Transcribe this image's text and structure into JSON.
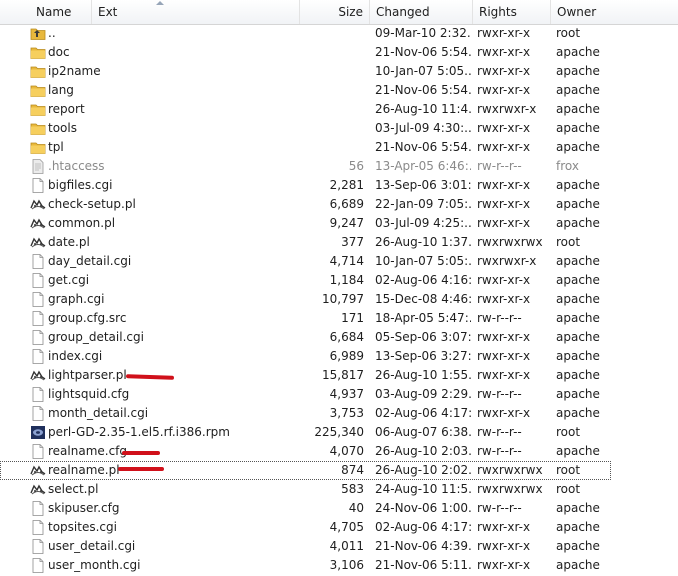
{
  "headers": {
    "name": "Name",
    "ext": "Ext",
    "size": "Size",
    "changed": "Changed",
    "rights": "Rights",
    "owner": "Owner"
  },
  "files": [
    {
      "name": "..",
      "size": "",
      "changed": "09-Mar-10 2:32...",
      "rights": "rwxr-xr-x",
      "owner": "root",
      "icon": "parent-dir-icon"
    },
    {
      "name": "doc",
      "size": "",
      "changed": "21-Nov-06 5:54...",
      "rights": "rwxr-xr-x",
      "owner": "apache",
      "icon": "folder-icon"
    },
    {
      "name": "ip2name",
      "size": "",
      "changed": "10-Jan-07 5:05...",
      "rights": "rwxr-xr-x",
      "owner": "apache",
      "icon": "folder-icon"
    },
    {
      "name": "lang",
      "size": "",
      "changed": "21-Nov-06 5:54...",
      "rights": "rwxr-xr-x",
      "owner": "apache",
      "icon": "folder-icon"
    },
    {
      "name": "report",
      "size": "",
      "changed": "26-Aug-10 11:4...",
      "rights": "rwxrwxr-x",
      "owner": "apache",
      "icon": "folder-icon"
    },
    {
      "name": "tools",
      "size": "",
      "changed": "03-Jul-09 4:30:...",
      "rights": "rwxr-xr-x",
      "owner": "apache",
      "icon": "folder-icon"
    },
    {
      "name": "tpl",
      "size": "",
      "changed": "21-Nov-06 5:54...",
      "rights": "rwxr-xr-x",
      "owner": "apache",
      "icon": "folder-icon"
    },
    {
      "name": ".htaccess",
      "size": "56",
      "changed": "13-Apr-05 6:46:...",
      "rights": "rw-r--r--",
      "owner": "frox",
      "icon": "text-file-icon"
    },
    {
      "name": "bigfiles.cgi",
      "size": "2,281",
      "changed": "13-Sep-06 3:01:...",
      "rights": "rwxr-xr-x",
      "owner": "apache",
      "icon": "file-icon"
    },
    {
      "name": "check-setup.pl",
      "size": "6,689",
      "changed": "22-Jan-09 7:05:...",
      "rights": "rwxr-xr-x",
      "owner": "apache",
      "icon": "perl-icon"
    },
    {
      "name": "common.pl",
      "size": "9,247",
      "changed": "03-Jul-09 4:25:...",
      "rights": "rwxr-xr-x",
      "owner": "apache",
      "icon": "perl-icon"
    },
    {
      "name": "date.pl",
      "size": "377",
      "changed": "26-Aug-10 1:37...",
      "rights": "rwxrwxrwx",
      "owner": "root",
      "icon": "perl-icon"
    },
    {
      "name": "day_detail.cgi",
      "size": "4,714",
      "changed": "10-Jan-07 5:05:...",
      "rights": "rwxrwxr-x",
      "owner": "apache",
      "icon": "file-icon"
    },
    {
      "name": "get.cgi",
      "size": "1,184",
      "changed": "02-Aug-06 4:16:...",
      "rights": "rwxr-xr-x",
      "owner": "apache",
      "icon": "file-icon"
    },
    {
      "name": "graph.cgi",
      "size": "10,797",
      "changed": "15-Dec-08 4:46:...",
      "rights": "rwxr-xr-x",
      "owner": "apache",
      "icon": "file-icon"
    },
    {
      "name": "group.cfg.src",
      "size": "171",
      "changed": "18-Apr-05 5:47:...",
      "rights": "rw-r--r--",
      "owner": "apache",
      "icon": "file-icon"
    },
    {
      "name": "group_detail.cgi",
      "size": "6,684",
      "changed": "05-Sep-06 3:07:...",
      "rights": "rwxr-xr-x",
      "owner": "apache",
      "icon": "file-icon"
    },
    {
      "name": "index.cgi",
      "size": "6,989",
      "changed": "13-Sep-06 3:27:...",
      "rights": "rwxr-xr-x",
      "owner": "apache",
      "icon": "file-icon"
    },
    {
      "name": "lightparser.pl",
      "size": "15,817",
      "changed": "26-Aug-10 1:55...",
      "rights": "rwxr-xr-x",
      "owner": "apache",
      "icon": "perl-icon"
    },
    {
      "name": "lightsquid.cfg",
      "size": "4,937",
      "changed": "03-Aug-09 2:29...",
      "rights": "rw-r--r--",
      "owner": "apache",
      "icon": "file-icon"
    },
    {
      "name": "month_detail.cgi",
      "size": "3,753",
      "changed": "02-Aug-06 4:17:...",
      "rights": "rwxr-xr-x",
      "owner": "apache",
      "icon": "file-icon"
    },
    {
      "name": "perl-GD-2.35-1.el5.rf.i386.rpm",
      "size": "225,340",
      "changed": "06-Aug-07 6:38...",
      "rights": "rw-r--r--",
      "owner": "root",
      "icon": "package-icon"
    },
    {
      "name": "realname.cfg",
      "size": "4,070",
      "changed": "26-Aug-10 2:03...",
      "rights": "rw-r--r--",
      "owner": "apache",
      "icon": "file-icon"
    },
    {
      "name": "realname.pl",
      "size": "874",
      "changed": "26-Aug-10 2:02...",
      "rights": "rwxrwxrwx",
      "owner": "root",
      "icon": "perl-icon"
    },
    {
      "name": "select.pl",
      "size": "583",
      "changed": "24-Aug-10 11:5...",
      "rights": "rwxrwxrwx",
      "owner": "root",
      "icon": "perl-icon"
    },
    {
      "name": "skipuser.cfg",
      "size": "40",
      "changed": "24-Nov-06 1:00...",
      "rights": "rw-r--r--",
      "owner": "apache",
      "icon": "file-icon"
    },
    {
      "name": "topsites.cgi",
      "size": "4,705",
      "changed": "02-Aug-06 4:17:...",
      "rights": "rwxr-xr-x",
      "owner": "apache",
      "icon": "file-icon"
    },
    {
      "name": "user_detail.cgi",
      "size": "4,011",
      "changed": "21-Nov-06 4:39...",
      "rights": "rwxr-xr-x",
      "owner": "apache",
      "icon": "file-icon"
    },
    {
      "name": "user_month.cgi",
      "size": "3,106",
      "changed": "21-Nov-06 5:11...",
      "rights": "rwxr-xr-x",
      "owner": "apache",
      "icon": "file-icon"
    }
  ],
  "colors": {
    "folder": "#e8b83c",
    "annotation": "#d0101a"
  }
}
